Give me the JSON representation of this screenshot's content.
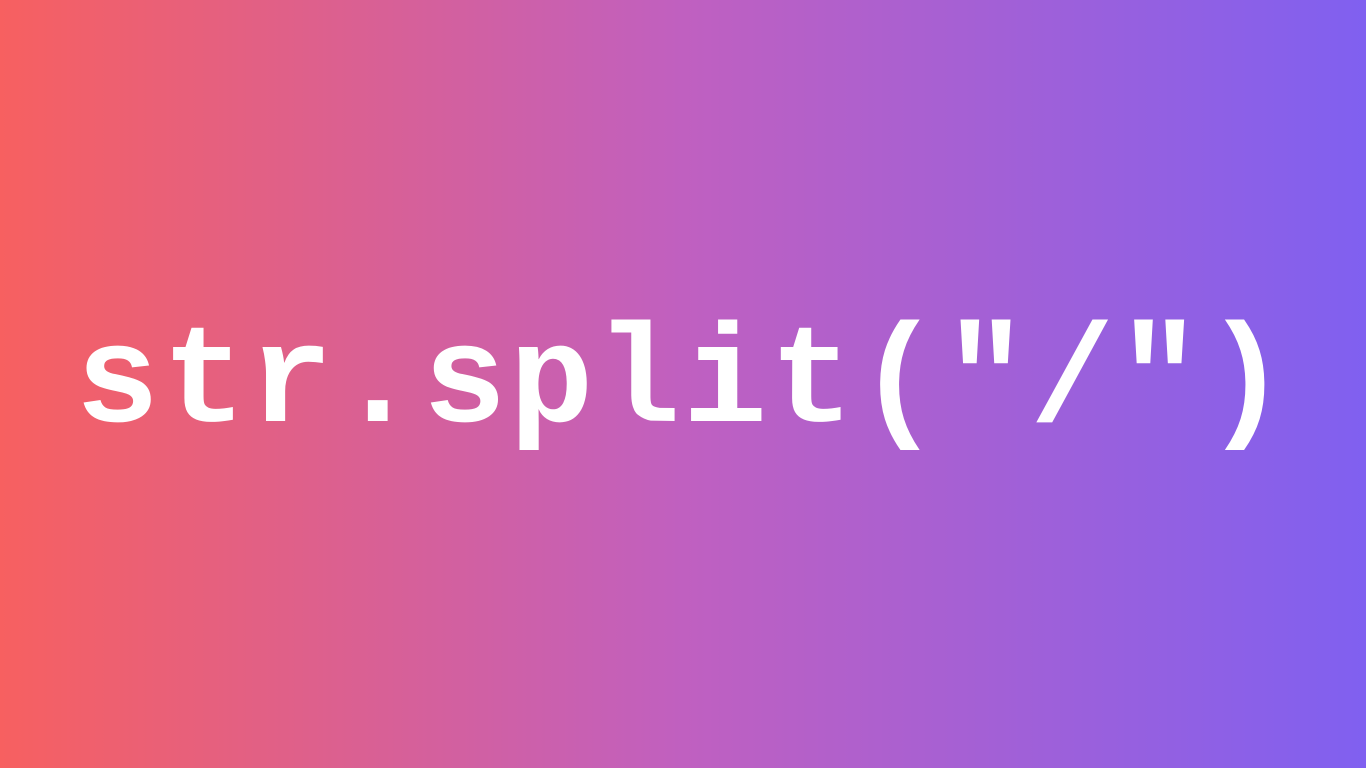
{
  "content": {
    "code": "str.split(\"/\")"
  },
  "colors": {
    "gradient_start": "#f76060",
    "gradient_mid": "#c060c0",
    "gradient_end": "#8060f0",
    "text": "#ffffff"
  }
}
